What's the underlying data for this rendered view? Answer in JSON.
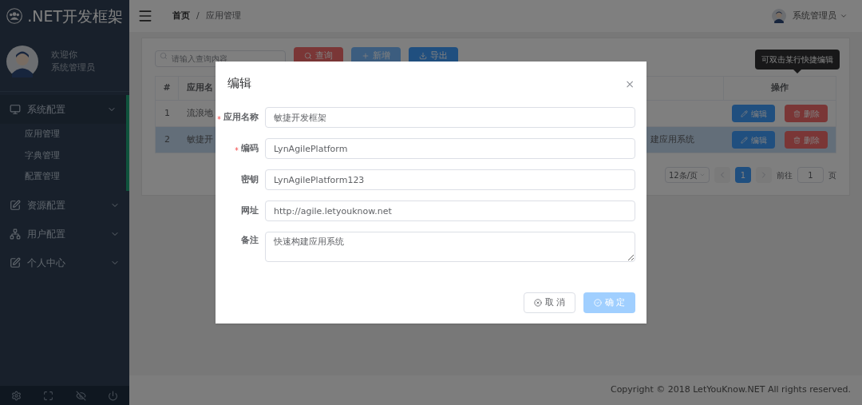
{
  "sidebar": {
    "logo": ".NET开发框架",
    "user": {
      "greeting": "欢迎你",
      "name": "系统管理员"
    },
    "menu": [
      {
        "label": "系统配置",
        "expanded": true,
        "children": [
          {
            "label": "应用管理"
          },
          {
            "label": "字典管理"
          },
          {
            "label": "配置管理"
          }
        ]
      },
      {
        "label": "资源配置",
        "expanded": false
      },
      {
        "label": "用户配置",
        "expanded": false
      },
      {
        "label": "个人中心",
        "expanded": false
      }
    ]
  },
  "header": {
    "breadcrumb": [
      "首页",
      "应用管理"
    ],
    "separator": "/",
    "user": "系统管理员"
  },
  "toolbar": {
    "search_placeholder": "请输入查询内容",
    "buttons": [
      {
        "label": "查询",
        "kind": "danger"
      },
      {
        "label": "新增",
        "kind": "light"
      },
      {
        "label": "导出",
        "kind": "primary"
      }
    ]
  },
  "tooltip": "可双击某行快捷编辑",
  "table": {
    "columns": [
      "#",
      "应用名",
      "操作"
    ],
    "rows": [
      {
        "index": "1",
        "name": "流浪地",
        "selected": false,
        "actions": [
          "编辑",
          "删除"
        ]
      },
      {
        "index": "2",
        "name": "敏捷开",
        "description": "建应用系统",
        "selected": true,
        "actions": [
          "编辑",
          "删除"
        ]
      }
    ]
  },
  "pagination": {
    "page_size": "12条/页",
    "pages": [
      {
        "label": "1",
        "selected": true
      }
    ],
    "goto_label": "前往",
    "goto_value": "1",
    "goto_suffix": "页"
  },
  "footer": "Copyright © 2018 LetYouKnow.NET All rights reserved.",
  "modal": {
    "title": "编辑",
    "close": "×",
    "fields": [
      {
        "label": "应用名称",
        "required": true,
        "kind": "input",
        "value": "敏捷开发框架"
      },
      {
        "label": "编码",
        "required": true,
        "kind": "input",
        "value": "LynAgilePlatform"
      },
      {
        "label": "密钥",
        "required": false,
        "kind": "input",
        "value": "LynAgilePlatform123"
      },
      {
        "label": "网址",
        "required": false,
        "kind": "input",
        "value": "http://agile.letyouknow.net"
      },
      {
        "label": "备注",
        "required": false,
        "kind": "textarea",
        "value": "快速构建应用系统"
      }
    ],
    "buttons": [
      {
        "label": "取 消",
        "kind": "default",
        "disabled": false
      },
      {
        "label": "确 定",
        "kind": "primary",
        "disabled": true
      }
    ]
  }
}
